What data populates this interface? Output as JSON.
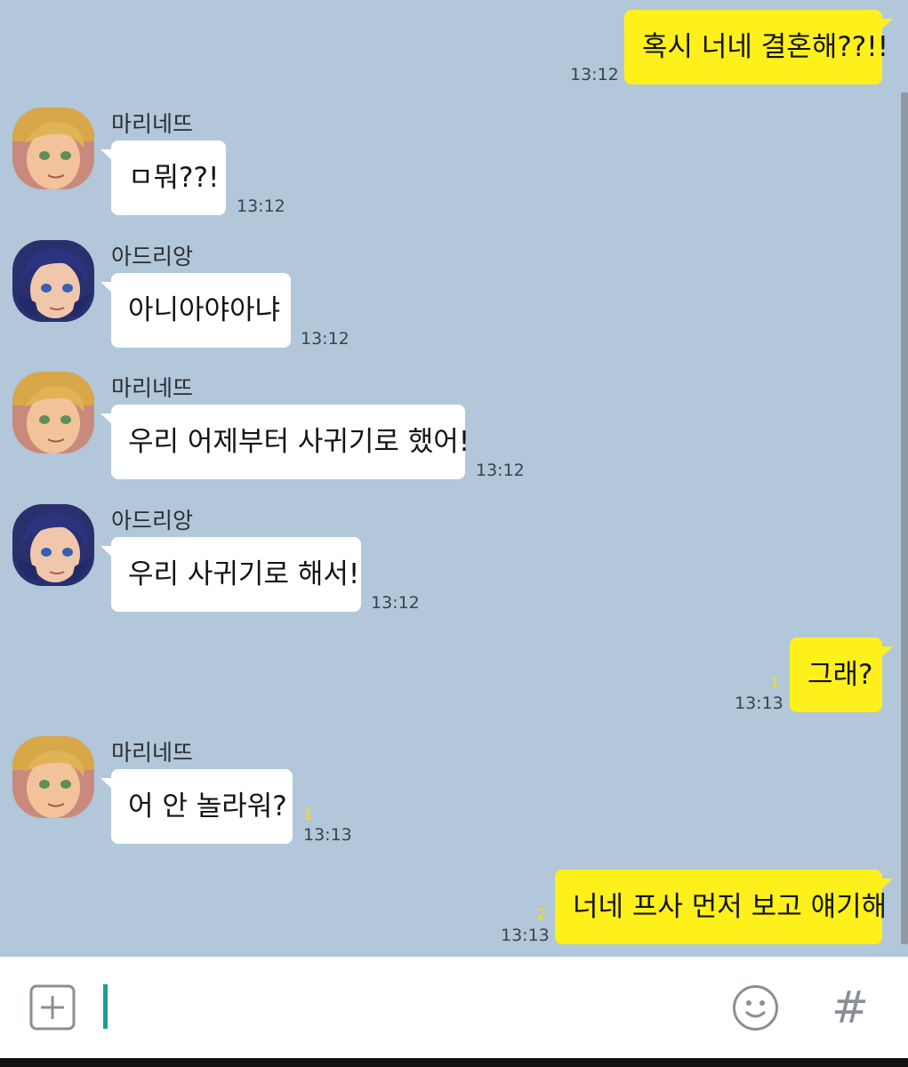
{
  "messages": [
    {
      "type": "out",
      "text": "혹시 너네 결혼해??!!",
      "time": "13:12",
      "unread": ""
    },
    {
      "type": "in",
      "sender": "마리네뜨",
      "avatar": "blonde-boy-avatar",
      "text": "ㅁ뭐??!",
      "time": "13:12",
      "unread": ""
    },
    {
      "type": "in",
      "sender": "아드리앙",
      "avatar": "blue-hair-girl-avatar",
      "text": "아니아야아냐",
      "time": "13:12",
      "unread": ""
    },
    {
      "type": "in",
      "sender": "마리네뜨",
      "avatar": "blonde-boy-avatar",
      "text": "우리 어제부터 사귀기로 했어!",
      "time": "13:12",
      "unread": ""
    },
    {
      "type": "in",
      "sender": "아드리앙",
      "avatar": "blue-hair-girl-avatar",
      "text": "우리 사귀기로 해서!",
      "time": "13:12",
      "unread": ""
    },
    {
      "type": "out",
      "text": "그래?",
      "time": "13:13",
      "unread": "1"
    },
    {
      "type": "in",
      "sender": "마리네뜨",
      "avatar": "blonde-boy-avatar",
      "text": "어 안 놀라워?",
      "time": "13:13",
      "unread": "1"
    },
    {
      "type": "out",
      "text": "너네 프사 먼저 보고 얘기해",
      "time": "13:13",
      "unread": "2"
    }
  ],
  "input_bar": {
    "value": "",
    "icons": [
      "plus-icon",
      "emoji-icon",
      "hashtag-icon"
    ],
    "hash_glyph": "#"
  },
  "colors": {
    "background": "#b2c7d9",
    "outgoing_bubble": "#fef01b",
    "incoming_bubble": "#ffffff",
    "unread_count": "#f5dd17",
    "cursor": "#1a9e8f"
  }
}
